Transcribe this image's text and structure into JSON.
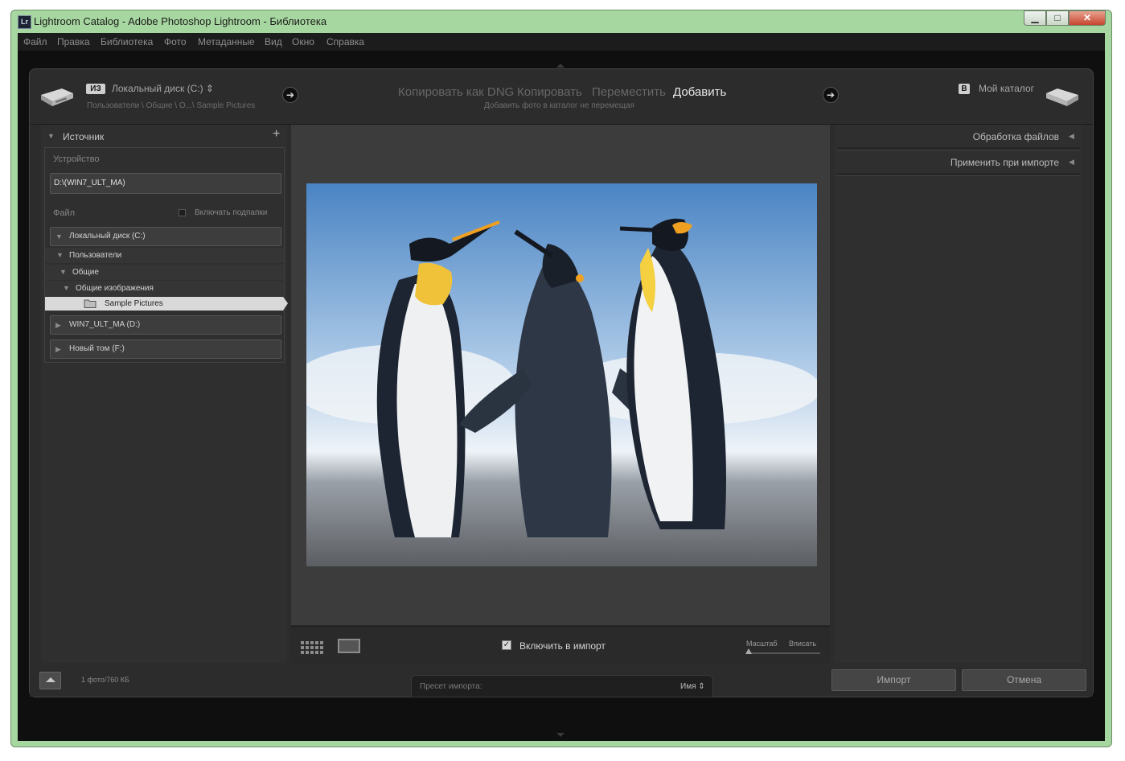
{
  "window": {
    "icon_label": "Lr",
    "title": "Lightroom Catalog - Adobe Photoshop Lightroom - Библиотека",
    "min_glyph": "▁",
    "max_glyph": "□",
    "close_glyph": "✕"
  },
  "menu": [
    "Файл",
    "Правка",
    "Библиотека",
    "Фото",
    "Метаданные",
    "Вид",
    "Окно",
    "Справка"
  ],
  "header": {
    "from_badge": "ИЗ",
    "from_source": "Локальный диск (C:) ⇕",
    "from_path": "Пользователи \\ Общие \\ О...\\ Sample Pictures",
    "modes": [
      "Копировать как DNG",
      "Копировать",
      "Переместить",
      "Добавить"
    ],
    "active_mode": "Добавить",
    "mode_hint": "Добавить фото в каталог не перемещая",
    "to_badge": "В",
    "to_target": "Мой каталог",
    "arrow_glyph": "➔"
  },
  "source_panel": {
    "title": "Источник",
    "add_glyph": "+",
    "device_label": "Устройство",
    "device_value": "D:\\(WIN7_ULT_MA)",
    "file_label": "Файл",
    "include_subfolders": "Включать подпапки",
    "tree": {
      "drive": "Локальный диск (C:)",
      "level1": "Пользователи",
      "level2": "Общие",
      "level3": "Общие изображения",
      "selected": "Sample Pictures"
    },
    "volumes": [
      "WIN7_ULT_MA (D:)",
      "Новый том (F:)"
    ]
  },
  "right_panel": {
    "sections": [
      "Обработка файлов",
      "Применить при импорте"
    ]
  },
  "toolbar": {
    "include_label": "Включить в импорт",
    "include_checked": true,
    "zoom_label": "Масштаб",
    "fit_label": "Вписать"
  },
  "footer": {
    "count": "1 фото/760 КБ",
    "preset_label": "Пресет импорта:",
    "preset_value": "Имя ⇕",
    "import_button": "Импорт",
    "cancel_button": "Отмена"
  },
  "colors": {
    "window_border": "#a7d7a0",
    "dialog_bg": "#2c2c2c",
    "panel_bg": "#2f2f2f",
    "active_text": "#e8e8e8",
    "inactive_text": "#676767"
  }
}
